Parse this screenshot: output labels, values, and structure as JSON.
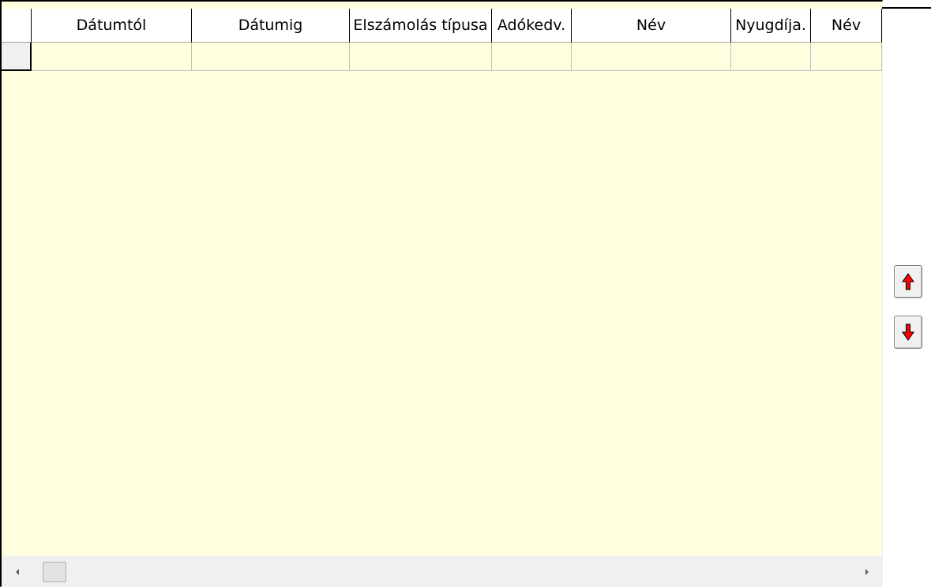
{
  "grid": {
    "columns": [
      {
        "label": "Dátumtól"
      },
      {
        "label": "Dátumig"
      },
      {
        "label": "Elszámolás típusa"
      },
      {
        "label": "Adókedv."
      },
      {
        "label": "Név"
      },
      {
        "label": "Nyugdíja."
      },
      {
        "label": "Név"
      }
    ],
    "rows": [
      [
        "",
        "",
        "",
        "",
        "",
        "",
        ""
      ]
    ],
    "background_color": "#ffffe0"
  },
  "scrollbar": {
    "left_arrow_icon": "chevron-left-icon",
    "right_arrow_icon": "chevron-right-icon"
  },
  "buttons": {
    "move_up_icon": "arrow-up-icon",
    "move_down_icon": "arrow-down-icon",
    "arrow_color": "#ff0000"
  }
}
